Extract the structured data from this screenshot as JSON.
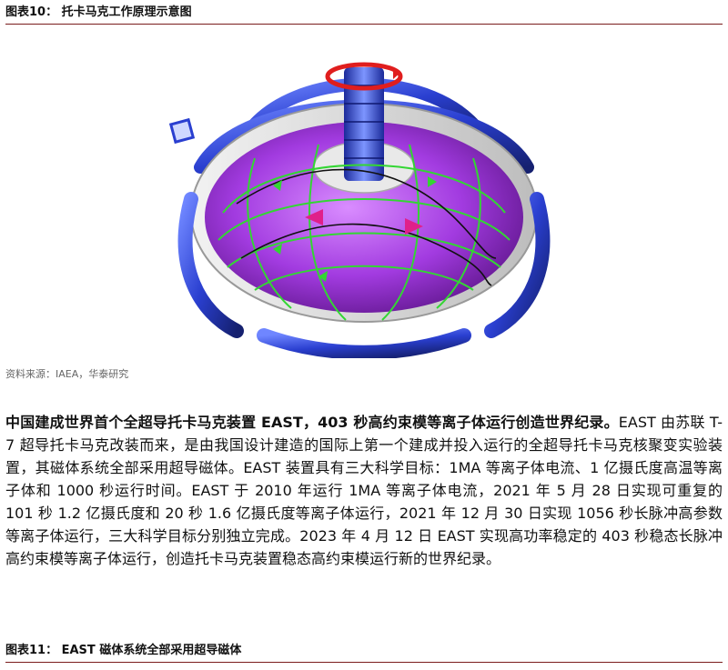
{
  "figure10": {
    "title": "图表10：  托卡马克工作原理示意图",
    "source": "资料来源：IAEA，华泰研究"
  },
  "paragraph": {
    "lead": "中国建成世界首个全超导托卡马克装置 EAST，403 秒高约束模等离子体运行创造世界纪录。",
    "body": "EAST 由苏联 T-7 超导托卡马克改装而来，是由我国设计建造的国际上第一个建成并投入运行的全超导托卡马克核聚变实验装置，其磁体系统全部采用超导磁体。EAST 装置具有三大科学目标：1MA 等离子体电流、1 亿摄氏度高温等离子体和 1000 秒运行时间。EAST 于 2010 年运行 1MA 等离子体电流，2021 年 5 月 28 日实现可重复的 101 秒 1.2 亿摄氏度和 20 秒 1.6 亿摄氏度等离子体运行，2021 年 12 月 30 日实现 1056 秒长脉冲高参数等离子体运行，三大科学目标分别独立完成。2023 年 4 月 12 日 EAST 实现高功率稳定的 403 秒稳态长脉冲高约束模等离子体运行，创造托卡马克装置稳态高约束模运行新的世界纪录。"
  },
  "figure11": {
    "title": "图表11：  EAST 磁体系统全部采用超导磁体"
  },
  "colors": {
    "rule": "#7a1c1c",
    "coil": "#2a3fd0",
    "plasma": "#a23be0",
    "field_lines": "#33d633",
    "current_ring": "#e01e1e"
  }
}
